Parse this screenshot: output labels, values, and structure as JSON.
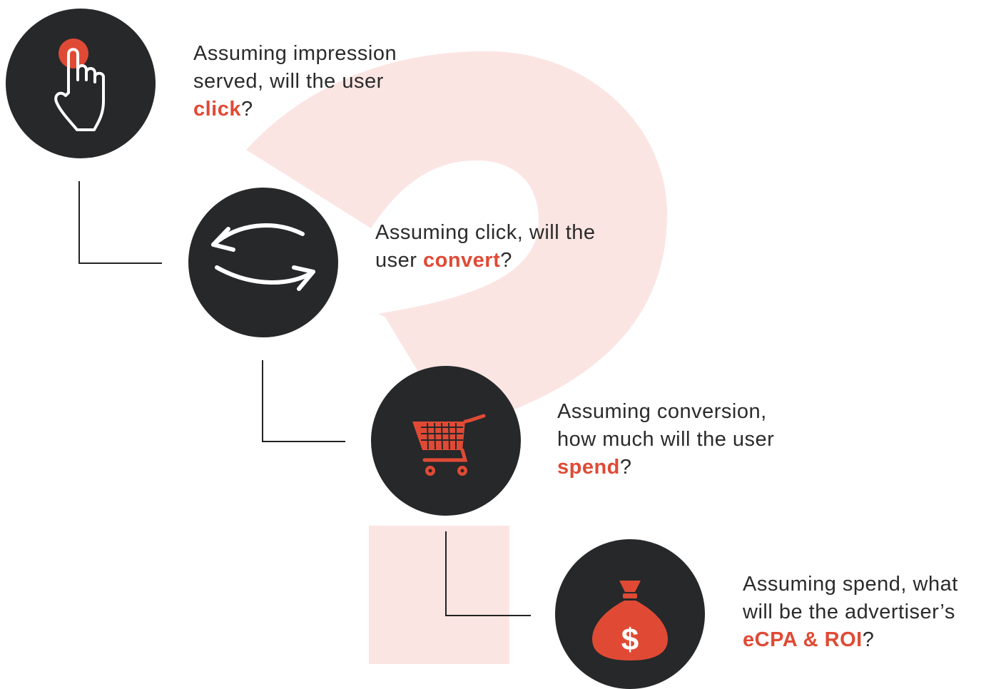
{
  "colors": {
    "accent": "#e04a35",
    "circle": "#26282a",
    "watermark": "#fbe5e3",
    "text": "#2b2b2b"
  },
  "steps": [
    {
      "icon": "hand-pointer-icon",
      "line1": "Assuming impression",
      "line2": "served, will the user",
      "line3_pre": "",
      "keyword": "click",
      "suffix": "?"
    },
    {
      "icon": "cycle-arrows-icon",
      "line1": "Assuming click, will the",
      "line2": "",
      "line3_pre": "user ",
      "keyword": "convert",
      "suffix": "?"
    },
    {
      "icon": "shopping-cart-icon",
      "line1": "Assuming conversion,",
      "line2": "how much will the user",
      "line3_pre": "",
      "keyword": "spend",
      "suffix": "?"
    },
    {
      "icon": "money-bag-icon",
      "line1": "Assuming spend, what",
      "line2": "will be the advertiser’s",
      "line3_pre": "",
      "keyword": "eCPA & ROI",
      "suffix": "?"
    }
  ],
  "money_symbol": "$"
}
